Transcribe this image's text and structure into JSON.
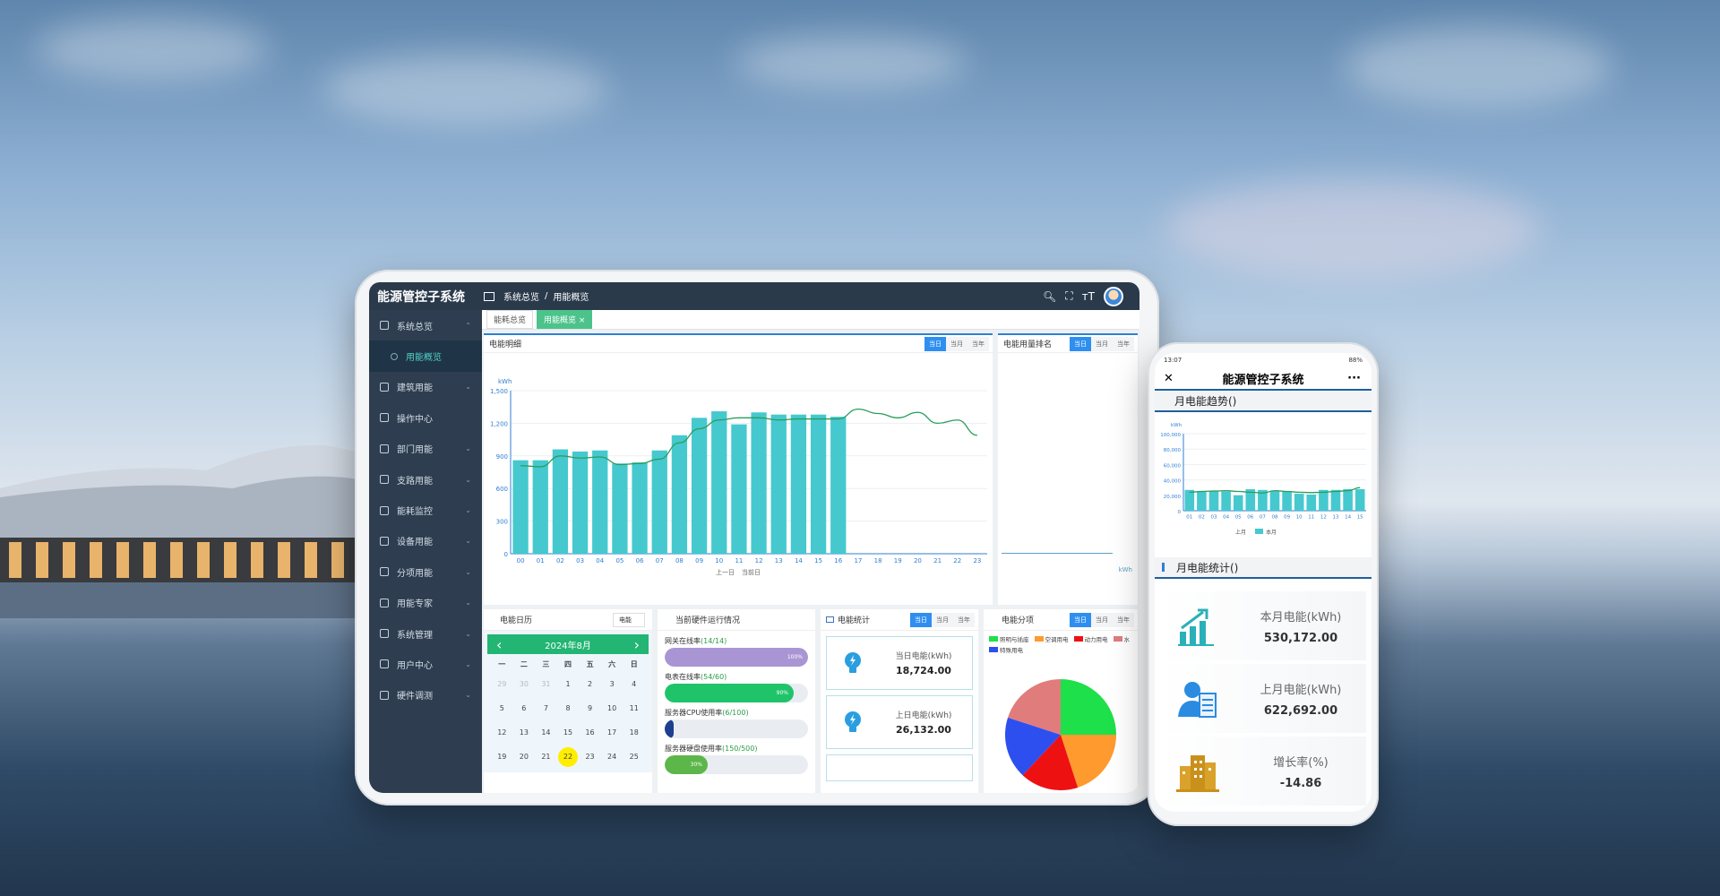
{
  "tablet": {
    "app_title": "能源管控子系统",
    "breadcrumb": [
      "系统总览",
      "/",
      "用能概览"
    ],
    "sidebar": {
      "items": [
        {
          "label": "系统总览"
        },
        {
          "label": "用能概览"
        },
        {
          "label": "建筑用能"
        },
        {
          "label": "操作中心"
        },
        {
          "label": "部门用能"
        },
        {
          "label": "支路用能"
        },
        {
          "label": "能耗监控"
        },
        {
          "label": "设备用能"
        },
        {
          "label": "分项用能"
        },
        {
          "label": "用能专家"
        },
        {
          "label": "系统管理"
        },
        {
          "label": "用户中心"
        },
        {
          "label": "硬件调测"
        }
      ]
    },
    "tabs": [
      {
        "label": "能耗总览"
      },
      {
        "label": "用能概览 ×"
      }
    ],
    "panel_detail": {
      "title": "电能明细",
      "buttons": [
        "当日",
        "当月",
        "当年"
      ]
    },
    "panel_rank": {
      "title": "电能用量排名",
      "buttons": [
        "当日",
        "当月",
        "当年"
      ],
      "unit": "kWh"
    },
    "calendar": {
      "title": "电能日历",
      "select": "电能",
      "month": "2024年8月",
      "prev": "‹",
      "next": "›",
      "weekdays": [
        "一",
        "二",
        "三",
        "四",
        "五",
        "六",
        "日"
      ],
      "days": [
        [
          "29",
          "30",
          "31",
          "1",
          "2",
          "3",
          "4"
        ],
        [
          "5",
          "6",
          "7",
          "8",
          "9",
          "10",
          "11"
        ],
        [
          "12",
          "13",
          "14",
          "15",
          "16",
          "17",
          "18"
        ],
        [
          "19",
          "20",
          "21",
          "22",
          "23",
          "24",
          "25"
        ]
      ],
      "today": "22"
    },
    "hardware": {
      "title": "当前硬件运行情况",
      "items": [
        {
          "label": "网关在线率",
          "detail": "(14/14)",
          "percent": 100,
          "text": "100%",
          "color": "#a995d3"
        },
        {
          "label": "电表在线率",
          "detail": "(54/60)",
          "percent": 90,
          "text": "90%",
          "color": "#1fc46a"
        },
        {
          "label": "服务器CPU使用率",
          "detail": "(6/100)",
          "percent": 6,
          "text": "",
          "color": "#1e3f8f"
        },
        {
          "label": "服务器硬盘使用率",
          "detail": "(150/500)",
          "percent": 30,
          "text": "30%",
          "color": "#5cb649"
        }
      ]
    },
    "energy_stats": {
      "title": "电能统计",
      "buttons": [
        "当日",
        "当月",
        "当年"
      ],
      "items": [
        {
          "label": "当日电能(kWh)",
          "value": "18,724.00"
        },
        {
          "label": "上日电能(kWh)",
          "value": "26,132.00"
        }
      ]
    },
    "energy_split": {
      "title": "电能分项",
      "buttons": [
        "当日",
        "当月",
        "当年"
      ],
      "legend": [
        {
          "name": "照明与插座",
          "color": "#1ee04a"
        },
        {
          "name": "空调用电",
          "color": "#ff9a2e"
        },
        {
          "name": "动力用电",
          "color": "#ee1111"
        },
        {
          "name": "水",
          "color": "#e07c7c"
        },
        {
          "name": "特殊用电",
          "color": "#2e4ff0"
        }
      ]
    }
  },
  "phone": {
    "status_time": "13:07",
    "status_battery": "88%",
    "title": "能源管控子系统",
    "close": "✕",
    "more": "···",
    "trend_title": "月电能趋势()",
    "stats_title": "月电能统计()",
    "stats": [
      {
        "label": "本月电能(kWh)",
        "value": "530,172.00",
        "icon": "chart-up-icon"
      },
      {
        "label": "上月电能(kWh)",
        "value": "622,692.00",
        "icon": "user-doc-icon"
      },
      {
        "label": "增长率(%)",
        "value": "-14.86",
        "icon": "building-icon"
      }
    ]
  },
  "chart_data": [
    {
      "type": "bar",
      "ylabel": "kWh",
      "xlabel": "时",
      "ylim": [
        0,
        1500
      ],
      "yticks": [
        "0",
        "300",
        "600",
        "900",
        "1,200",
        "1,500"
      ],
      "categories": [
        "00",
        "01",
        "02",
        "03",
        "04",
        "05",
        "06",
        "07",
        "08",
        "09",
        "10",
        "11",
        "12",
        "13",
        "14",
        "15",
        "16",
        "17",
        "18",
        "19",
        "20",
        "21",
        "22",
        "23"
      ],
      "series": [
        {
          "name": "上一日",
          "kind": "line",
          "color": "#2a9d5c",
          "values": [
            810,
            800,
            900,
            880,
            890,
            820,
            830,
            870,
            1020,
            1150,
            1230,
            1250,
            1250,
            1230,
            1240,
            1240,
            1240,
            1330,
            1290,
            1250,
            1300,
            1200,
            1230,
            1090
          ]
        },
        {
          "name": "当前日",
          "kind": "bar",
          "color": "#45c9cf",
          "values": [
            860,
            860,
            960,
            940,
            950,
            830,
            840,
            950,
            1090,
            1250,
            1310,
            1190,
            1300,
            1280,
            1280,
            1280,
            1260,
            null,
            null,
            null,
            null,
            null,
            null,
            null
          ]
        }
      ],
      "legend": [
        "上一日",
        "当前日"
      ]
    },
    {
      "type": "bar",
      "ylabel": "kWh",
      "ylim": [
        0,
        100000
      ],
      "yticks": [
        "0",
        "20,000",
        "40,000",
        "60,000",
        "80,000",
        "100,000"
      ],
      "categories": [
        "01",
        "02",
        "03",
        "04",
        "05",
        "06",
        "07",
        "08",
        "09",
        "10",
        "11",
        "12",
        "13",
        "14",
        "15"
      ],
      "series": [
        {
          "name": "上月",
          "kind": "line",
          "color": "#2a9d5c",
          "values": [
            24000,
            25000,
            25500,
            26000,
            25000,
            24000,
            23000,
            26000,
            25000,
            24000,
            23500,
            24000,
            25000,
            26000,
            30000
          ]
        },
        {
          "name": "本月",
          "kind": "bar",
          "color": "#45c9cf",
          "values": [
            27000,
            25000,
            26000,
            25000,
            20000,
            28000,
            27000,
            26000,
            25000,
            22000,
            21000,
            27000,
            27000,
            28000,
            28000
          ]
        }
      ],
      "legend": [
        "上月",
        "本月"
      ]
    },
    {
      "type": "pie",
      "values": [
        {
          "name": "照明与插座",
          "value": 25,
          "color": "#1ee04a"
        },
        {
          "name": "空调用电",
          "value": 20,
          "color": "#ff9a2e"
        },
        {
          "name": "动力用电",
          "value": 17,
          "color": "#ee1111"
        },
        {
          "name": "特殊用电",
          "value": 18,
          "color": "#2e4ff0"
        },
        {
          "name": "水",
          "value": 20,
          "color": "#e07c7c"
        }
      ]
    }
  ]
}
